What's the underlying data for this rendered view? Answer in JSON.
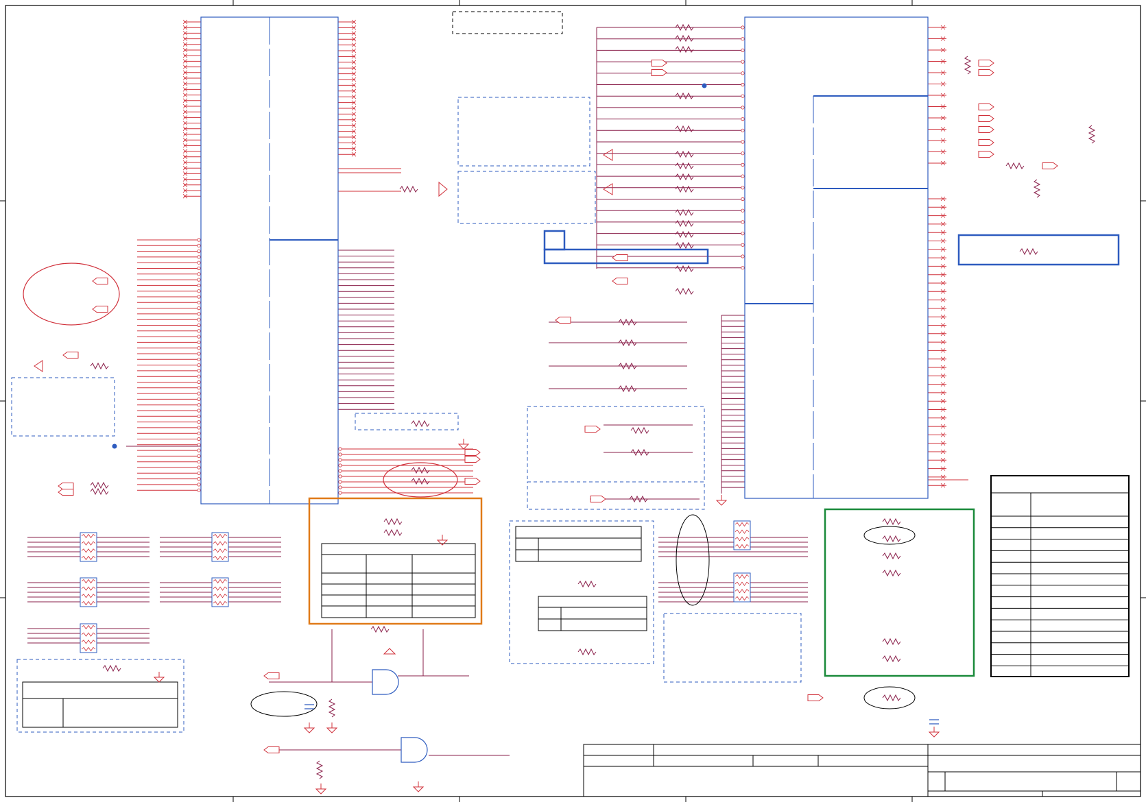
{
  "sheet": {
    "title_block": {
      "title": "",
      "document_number": "",
      "revision": "",
      "sheet": ""
    }
  },
  "colors": {
    "wire": "#d0303a",
    "net": "#8a1f4a",
    "component": "#2d5bbf",
    "frame": "#000000",
    "highlight_orange": "#e07a18",
    "highlight_green": "#1a8a3a"
  }
}
